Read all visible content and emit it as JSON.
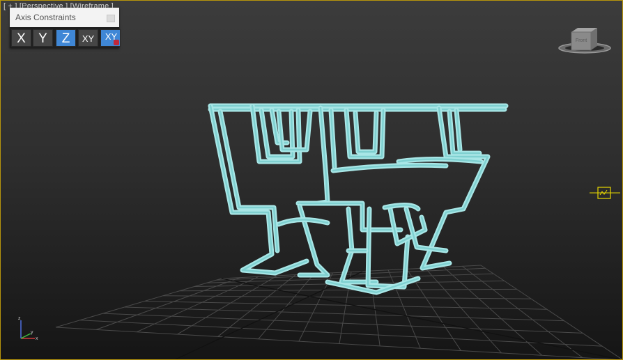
{
  "viewport": {
    "label": "[ + ] [Perspective ] [Wireframe ]",
    "border_color": "#b8960c",
    "background_top": "#3c3c3c",
    "background_bottom": "#151515"
  },
  "axis_constraints": {
    "title": "Axis Constraints",
    "close_icon": "close-icon",
    "buttons": [
      {
        "label": "X",
        "active": false
      },
      {
        "label": "Y",
        "active": false
      },
      {
        "label": "Z",
        "active": true
      },
      {
        "label": "XY",
        "active": false
      },
      {
        "label": "XY",
        "active": true,
        "icon": "lock-icon"
      }
    ],
    "active_color": "#3f87d6"
  },
  "view_cube": {
    "face_label": "Front",
    "icon": "view-cube-icon"
  },
  "gizmo": {
    "icon": "transform-gizmo-icon",
    "color": "#e8d800"
  },
  "world_axis": {
    "x": "x",
    "y": "y",
    "z": "z"
  },
  "object": {
    "style": "wireframe",
    "color": "#a8e6e6"
  },
  "grid": {
    "color": "#4a4a4a"
  }
}
